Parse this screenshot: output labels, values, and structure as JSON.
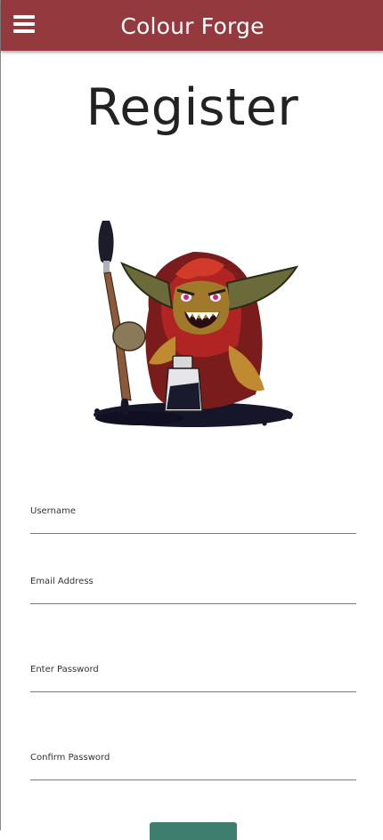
{
  "header": {
    "title": "Colour Forge",
    "menu_icon": "hamburger-menu-icon",
    "background_color": "#943a3e"
  },
  "page": {
    "title": "Register"
  },
  "mascot": {
    "icon": "goblin-painter-illustration"
  },
  "form": {
    "fields": [
      {
        "label": "Username",
        "value": ""
      },
      {
        "label": "Email Address",
        "value": ""
      },
      {
        "label": "Enter Password",
        "value": ""
      },
      {
        "label": "Confirm Password",
        "value": ""
      }
    ],
    "submit_label": "",
    "submit_color": "#3e7e6e"
  }
}
